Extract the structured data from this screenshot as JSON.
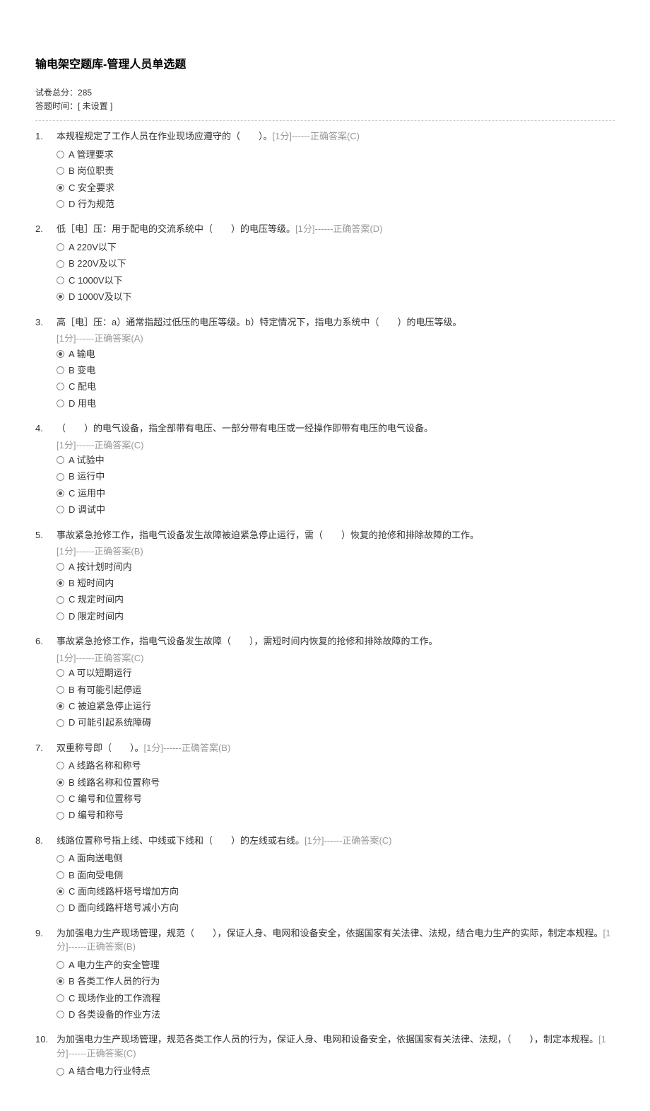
{
  "title": "输电架空题库-管理人员单选题",
  "meta": {
    "total_label": "试卷总分：",
    "total_value": "285",
    "time_label": "答题时间：",
    "time_value": "[ 未设置 ]"
  },
  "pts_prefix": "[1分]------正确答案(",
  "pts_suffix": ")",
  "questions": [
    {
      "num": "1.",
      "stem": "本规程规定了工作人员在作业现场应遵守的（　　）。",
      "answer": "C",
      "inline_answer": true,
      "options": [
        {
          "label": "A",
          "text": "管理要求",
          "selected": false
        },
        {
          "label": "B",
          "text": "岗位职责",
          "selected": false
        },
        {
          "label": "C",
          "text": "安全要求",
          "selected": true
        },
        {
          "label": "D",
          "text": "行为规范",
          "selected": false
        }
      ]
    },
    {
      "num": "2.",
      "stem": "低［电］压：用于配电的交流系统中（　　）的电压等级。",
      "answer": "D",
      "inline_answer": true,
      "options": [
        {
          "label": "A",
          "text": "220V以下",
          "selected": false
        },
        {
          "label": "B",
          "text": "220V及以下",
          "selected": false
        },
        {
          "label": "C",
          "text": "1000V以下",
          "selected": false
        },
        {
          "label": "D",
          "text": "1000V及以下",
          "selected": true
        }
      ]
    },
    {
      "num": "3.",
      "stem": "高［电］压：a）通常指超过低压的电压等级。b）特定情况下，指电力系统中（　　）的电压等级。",
      "answer": "A",
      "inline_answer": false,
      "options": [
        {
          "label": "A",
          "text": "输电",
          "selected": true
        },
        {
          "label": "B",
          "text": "变电",
          "selected": false
        },
        {
          "label": "C",
          "text": "配电",
          "selected": false
        },
        {
          "label": "D",
          "text": "用电",
          "selected": false
        }
      ]
    },
    {
      "num": "4.",
      "stem": "（　　）的电气设备，指全部带有电压、一部分带有电压或一经操作即带有电压的电气设备。",
      "answer": "C",
      "inline_answer": false,
      "options": [
        {
          "label": "A",
          "text": "试验中",
          "selected": false
        },
        {
          "label": "B",
          "text": "运行中",
          "selected": false
        },
        {
          "label": "C",
          "text": "运用中",
          "selected": true
        },
        {
          "label": "D",
          "text": "调试中",
          "selected": false
        }
      ]
    },
    {
      "num": "5.",
      "stem": "事故紧急抢修工作，指电气设备发生故障被迫紧急停止运行，需（　　）恢复的抢修和排除故障的工作。",
      "answer": "B",
      "inline_answer": false,
      "options": [
        {
          "label": "A",
          "text": "按计划时间内",
          "selected": false
        },
        {
          "label": "B",
          "text": "短时间内",
          "selected": true
        },
        {
          "label": "C",
          "text": "规定时间内",
          "selected": false
        },
        {
          "label": "D",
          "text": "限定时间内",
          "selected": false
        }
      ]
    },
    {
      "num": "6.",
      "stem": "事故紧急抢修工作，指电气设备发生故障（　　），需短时间内恢复的抢修和排除故障的工作。",
      "answer": "C",
      "inline_answer": false,
      "options": [
        {
          "label": "A",
          "text": "可以短期运行",
          "selected": false
        },
        {
          "label": "B",
          "text": "有可能引起停运",
          "selected": false
        },
        {
          "label": "C",
          "text": "被迫紧急停止运行",
          "selected": true
        },
        {
          "label": "D",
          "text": "可能引起系统障碍",
          "selected": false
        }
      ]
    },
    {
      "num": "7.",
      "stem": "双重称号即（　　）。",
      "answer": "B",
      "inline_answer": true,
      "options": [
        {
          "label": "A",
          "text": "线路名称和称号",
          "selected": false
        },
        {
          "label": "B",
          "text": "线路名称和位置称号",
          "selected": true
        },
        {
          "label": "C",
          "text": "编号和位置称号",
          "selected": false
        },
        {
          "label": "D",
          "text": "编号和称号",
          "selected": false
        }
      ]
    },
    {
      "num": "8.",
      "stem": "线路位置称号指上线、中线或下线和（　　）的左线或右线。",
      "answer": "C",
      "inline_answer": true,
      "options": [
        {
          "label": "A",
          "text": "面向送电侧",
          "selected": false
        },
        {
          "label": "B",
          "text": "面向受电侧",
          "selected": false
        },
        {
          "label": "C",
          "text": "面向线路杆塔号增加方向",
          "selected": true
        },
        {
          "label": "D",
          "text": "面向线路杆塔号减小方向",
          "selected": false
        }
      ]
    },
    {
      "num": "9.",
      "stem": "为加强电力生产现场管理，规范（　　），保证人身、电网和设备安全，依据国家有关法律、法规，结合电力生产的实际，制定本规程。",
      "answer": "B",
      "inline_answer": true,
      "options": [
        {
          "label": "A",
          "text": "电力生产的安全管理",
          "selected": false
        },
        {
          "label": "B",
          "text": "各类工作人员的行为",
          "selected": true
        },
        {
          "label": "C",
          "text": "现场作业的工作流程",
          "selected": false
        },
        {
          "label": "D",
          "text": "各类设备的作业方法",
          "selected": false
        }
      ]
    },
    {
      "num": "10.",
      "stem": "为加强电力生产现场管理，规范各类工作人员的行为，保证人身、电网和设备安全，依据国家有关法律、法规，（　　），制定本规程。",
      "answer": "C",
      "inline_answer": true,
      "options": [
        {
          "label": "A",
          "text": "结合电力行业特点",
          "selected": false
        }
      ]
    }
  ]
}
